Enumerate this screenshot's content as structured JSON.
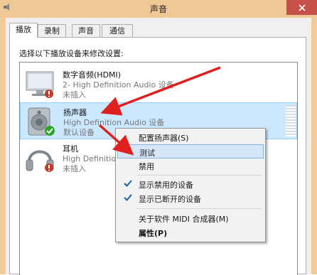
{
  "window": {
    "title": "声音"
  },
  "tabs": [
    {
      "label": "播放"
    },
    {
      "label": "录制"
    },
    {
      "label": "声音"
    },
    {
      "label": "通信"
    }
  ],
  "instructions": "选择以下播放设备来修改设置:",
  "devices": [
    {
      "name": "数字音频(HDMI)",
      "description": "2- High Definition Audio 设备",
      "status": "未插入"
    },
    {
      "name": "扬声器",
      "description": "High Definition Audio 设备",
      "status": "默认设备"
    },
    {
      "name": "耳机",
      "description": "High Definition Audio 设备",
      "status": "未插入"
    }
  ],
  "context_menu": {
    "items": [
      {
        "label": "配置扬声器(S)"
      },
      {
        "label": "测试"
      },
      {
        "label": "禁用"
      },
      {
        "label": "显示禁用的设备",
        "checked": true
      },
      {
        "label": "显示已断开的设备",
        "checked": true
      },
      {
        "label": "关于软件 MIDI 合成器(M)"
      },
      {
        "label": "属性(P)"
      }
    ]
  },
  "colors": {
    "titlebar": "#f0c896",
    "close_button": "#c7504b",
    "selection": "#cce8ff",
    "menu_highlight": "#d5e7f8",
    "annotation_arrow": "#e02020",
    "default_check": "#2aa52a"
  }
}
